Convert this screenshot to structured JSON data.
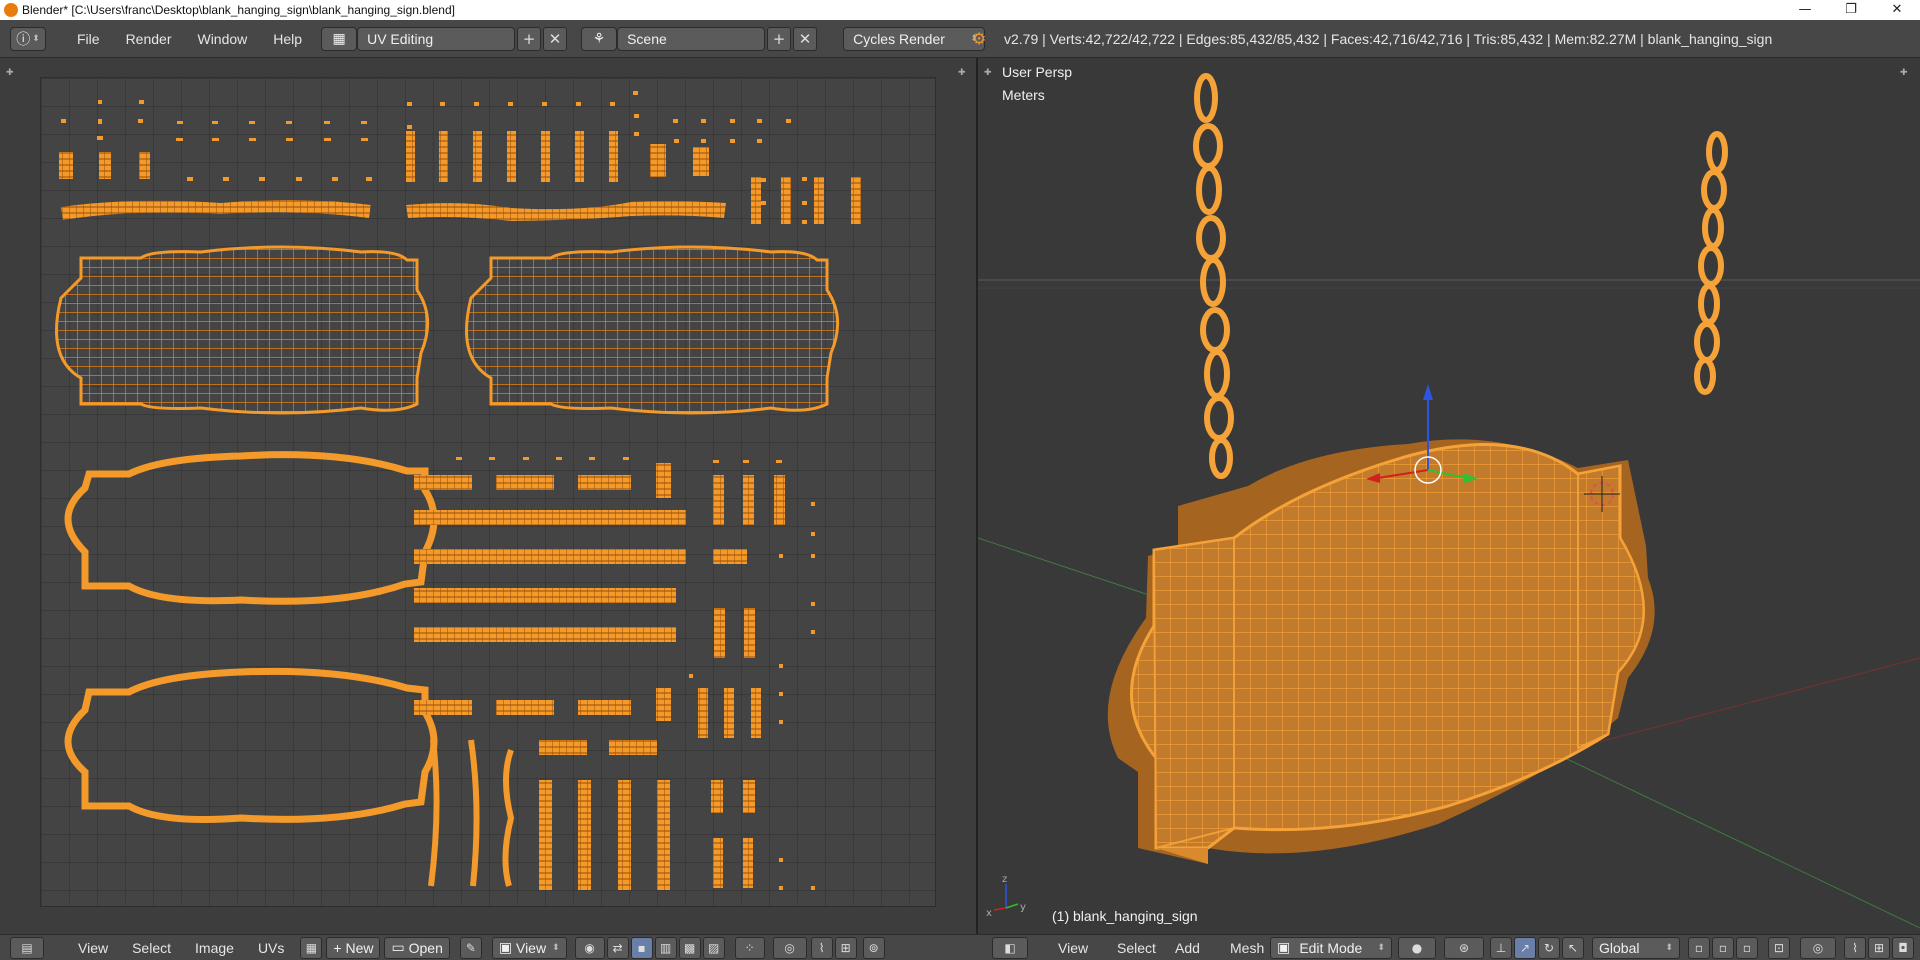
{
  "window": {
    "title": "Blender* [C:\\Users\\franc\\Desktop\\blank_hanging_sign\\blank_hanging_sign.blend]",
    "minimize": "—",
    "maximize": "❐",
    "close": "✕"
  },
  "menu": [
    "File",
    "Render",
    "Window",
    "Help"
  ],
  "screen_layout": "UV Editing",
  "scene": "Scene",
  "render_engine": "Cycles Render",
  "stats": "v2.79 | Verts:42,722/42,722 | Edges:85,432/85,432 | Faces:42,716/42,716 | Tris:85,432 | Mem:82.27M | blank_hanging_sign",
  "viewport": {
    "view_name": "User Persp",
    "units": "Meters",
    "object_label": "(1) blank_hanging_sign",
    "axis_x": "x",
    "axis_y": "y",
    "axis_z": "z"
  },
  "uv_footer": {
    "view": "View",
    "select": "Select",
    "image": "Image",
    "uvs": "UVs",
    "new": "New",
    "open": "Open",
    "view2": "View"
  },
  "view3d_footer": {
    "view": "View",
    "select": "Select",
    "add": "Add",
    "mesh": "Mesh",
    "mode": "Edit Mode",
    "orientation": "Global"
  },
  "colors": {
    "mesh": "#f39a2b",
    "mesh_dark": "#c86a10",
    "background": "#393939"
  }
}
